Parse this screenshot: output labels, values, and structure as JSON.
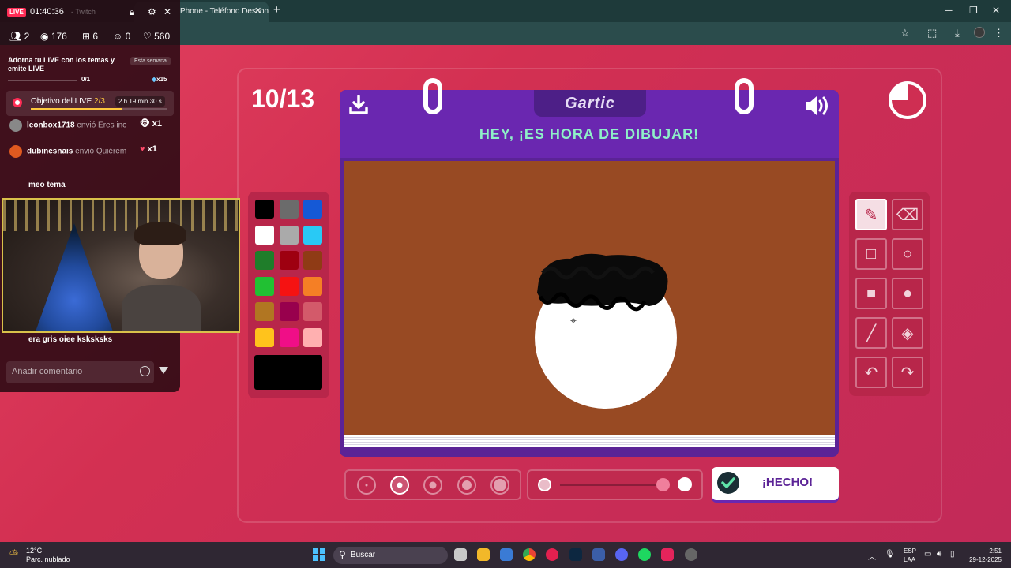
{
  "browser": {
    "tab_title": "Phone - Teléfono Descon",
    "tab_ghost": "- Twitch",
    "new_tab": "+",
    "close": "✕"
  },
  "game": {
    "round": "10/13",
    "logo": "Gartic",
    "instruction": "HEY, ¡ES HORA DE DIBUJAR!",
    "done_label": "¡HECHO!",
    "timer_remaining_fraction": 0.75,
    "palette": [
      "#000000",
      "#6b6b6b",
      "#1559d6",
      "#ffffff",
      "#aaaaaa",
      "#29c9f5",
      "#1f7d2a",
      "#9e0010",
      "#8f3b15",
      "#21c033",
      "#f51212",
      "#f57f25",
      "#b17622",
      "#98004d",
      "#d35a6a",
      "#ffc31c",
      "#f00e87",
      "#ffb0b0"
    ],
    "current_color": "#000000",
    "canvas_color": "#984a23",
    "brush_sizes": [
      "1",
      "2",
      "3",
      "4",
      "5"
    ],
    "active_brush_size": "2",
    "opacity_percent": 100,
    "tools": [
      "pencil",
      "eraser",
      "rectangle-outline",
      "ellipse-outline",
      "rectangle-fill",
      "ellipse-fill",
      "line",
      "fill-bucket",
      "undo",
      "redo"
    ],
    "active_tool": "pencil"
  },
  "live": {
    "badge": "LIVE",
    "duration": "01:40:36",
    "stats": {
      "viewers_icon_count": "2",
      "views": "176",
      "gifts": "6",
      "guests": "0",
      "likes": "560"
    },
    "promo_text": "Adorna tu LIVE con los temas y emite LIVE",
    "promo_tag": "Esta semana",
    "promo_progress": "0/1",
    "promo_multiplier": "x15",
    "goal_label": "Objetivo del LIVE",
    "goal_progress": "2/3",
    "goal_progress_fraction": 0.67,
    "goal_timer": "2 h 19 min 30 s",
    "chat": [
      {
        "user": "leonbox1718",
        "text": "envió Eres inc",
        "gift": "x1"
      },
      {
        "user": "dubinesnais",
        "text": "envió Quiérem",
        "gift": "x1"
      },
      {
        "user": "",
        "text": "meo tema",
        "gift": ""
      },
      {
        "user": "",
        "text": "era gris oiee ksksksks",
        "gift": ""
      }
    ],
    "comment_placeholder": "Añadir comentario"
  },
  "taskbar": {
    "temperature": "12°C",
    "weather": "Parc. nublado",
    "search": "Buscar",
    "lang_top": "ESP",
    "lang_bottom": "LAA",
    "time": "2:51",
    "date": "29-12-2025"
  },
  "colors": {
    "accent_purple": "#6a27b0",
    "instruction_green": "#8ef0c8",
    "live_red": "#ff2c55",
    "goal_yellow": "#ffc83d"
  }
}
